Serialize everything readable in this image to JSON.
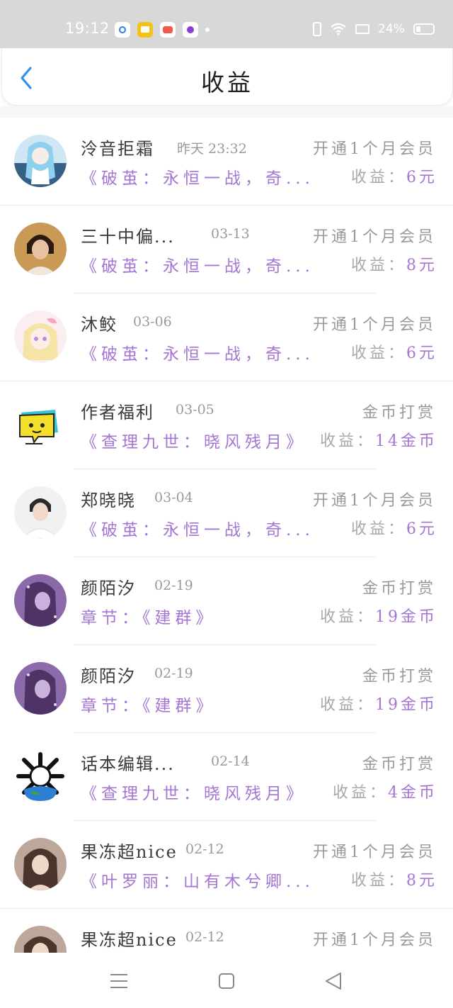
{
  "status_bar": {
    "time": "19:12",
    "battery": "24%"
  },
  "header": {
    "title": "收益"
  },
  "colors": {
    "accent_purple": "#a575d4",
    "back_blue": "#2d8ff0"
  },
  "rows": [
    {
      "name": "泠音拒霜",
      "date": "昨天 23:32",
      "type": "开通1个月会员",
      "work": "《破茧：永恒一战，奇...",
      "earn_label": "收益：",
      "earn_value": "6元",
      "avatar": "avatar-anime-blue"
    },
    {
      "name": "三十中偏...",
      "date": "03-13",
      "type": "开通1个月会员",
      "work": "《破茧：永恒一战，奇...",
      "earn_label": "收益：",
      "earn_value": "8元",
      "avatar": "avatar-person-brown"
    },
    {
      "name": "沐鲛",
      "date": "03-06",
      "type": "开通1个月会员",
      "work": "《破茧：永恒一战，奇...",
      "earn_label": "收益：",
      "earn_value": "6元",
      "avatar": "avatar-anime-pink"
    },
    {
      "name": "作者福利",
      "date": "03-05",
      "type": "金币打赏",
      "work": "《查理九世：晓风残月》",
      "earn_label": "收益：",
      "earn_value": "14金币",
      "avatar": "avatar-chat-bubble"
    },
    {
      "name": "郑晓晓",
      "date": "03-04",
      "type": "开通1个月会员",
      "work": "《破茧：永恒一战，奇...",
      "earn_label": "收益：",
      "earn_value": "6元",
      "avatar": "avatar-person-white"
    },
    {
      "name": "颜陌汐",
      "date": "02-19",
      "type": "金币打赏",
      "work": "章节：《建群》",
      "earn_label": "收益：",
      "earn_value": "19金币",
      "avatar": "avatar-purple"
    },
    {
      "name": "颜陌汐",
      "date": "02-19",
      "type": "金币打赏",
      "work": "章节：《建群》",
      "earn_label": "收益：",
      "earn_value": "19金币",
      "avatar": "avatar-purple"
    },
    {
      "name": "话本编辑...",
      "date": "02-14",
      "type": "金币打赏",
      "work": "《查理九世：晓风残月》",
      "earn_label": "收益：",
      "earn_value": "4金币",
      "avatar": "avatar-globe"
    },
    {
      "name": "果冻超nice",
      "date": "02-12",
      "type": "开通1个月会员",
      "work": "《叶罗丽：山有木兮卿...",
      "earn_label": "收益：",
      "earn_value": "8元",
      "avatar": "avatar-girl"
    },
    {
      "name": "果冻超nice",
      "date": "02-12",
      "type": "开通1个月会员",
      "work": "",
      "earn_label": "",
      "earn_value": "",
      "avatar": "avatar-girl"
    }
  ],
  "nav": {
    "menu_icon": "menu-icon",
    "home_icon": "home-square-icon",
    "back_icon": "back-triangle-icon"
  }
}
